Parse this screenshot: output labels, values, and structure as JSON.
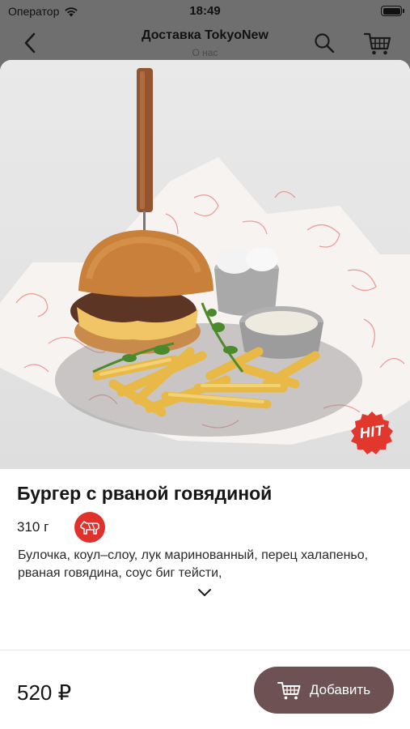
{
  "status_bar": {
    "carrier": "Оператор",
    "time": "18:49",
    "icons": [
      "wifi-icon",
      "battery-icon"
    ]
  },
  "nav": {
    "title": "Доставка TokyoNew",
    "subtitle": "О нас",
    "icons": [
      "back-chevron-icon",
      "search-icon",
      "cart-icon"
    ]
  },
  "product": {
    "badge": "HIT",
    "title": "Бургер с рваной говядиной",
    "weight": "310 г",
    "tag_icon": "meat-icon",
    "description": "Булочка, коул–слоу, лук маринованный, перец халапеньо, рваная говядина, соус биг тейсти,",
    "price": "520 ₽",
    "add_label": "Добавить"
  },
  "colors": {
    "accent": "#6d5153",
    "badge_red": "#e2372d",
    "tag_red": "#e0322c"
  }
}
